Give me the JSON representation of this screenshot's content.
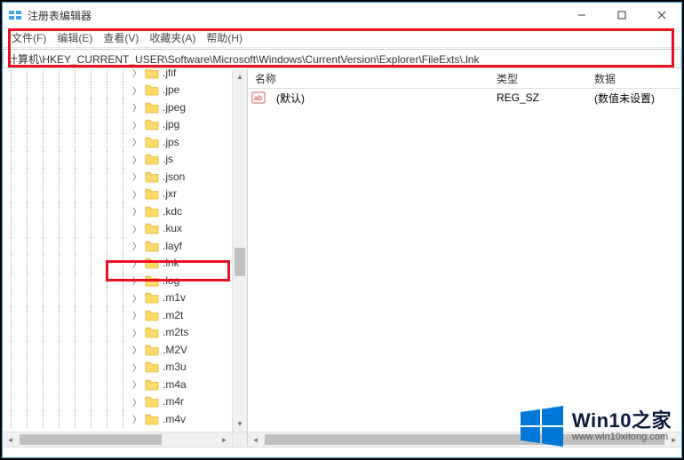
{
  "window": {
    "title": "注册表编辑器"
  },
  "menu": {
    "file": "文件(F)",
    "edit": "编辑(E)",
    "view": "查看(V)",
    "fav": "收藏夹(A)",
    "help": "帮助(H)"
  },
  "address": "计算机\\HKEY_CURRENT_USER\\Software\\Microsoft\\Windows\\CurrentVersion\\Explorer\\FileExts\\.lnk",
  "tree": [
    ".jfif",
    ".jpe",
    ".jpeg",
    ".jpg",
    ".jps",
    ".js",
    ".json",
    ".jxr",
    ".kdc",
    ".kux",
    ".layf",
    ".lnk",
    ".log",
    ".m1v",
    ".m2t",
    ".m2ts",
    ".M2V",
    ".m3u",
    ".m4a",
    ".m4r",
    ".m4v"
  ],
  "selected_index": 11,
  "list": {
    "headers": {
      "name": "名称",
      "type": "类型",
      "data": "数据"
    },
    "rows": [
      {
        "name": "(默认)",
        "type": "REG_SZ",
        "data": "(数值未设置)"
      }
    ]
  },
  "watermark": {
    "main": "Win10之家",
    "sub": "www.win10xitong.com"
  }
}
